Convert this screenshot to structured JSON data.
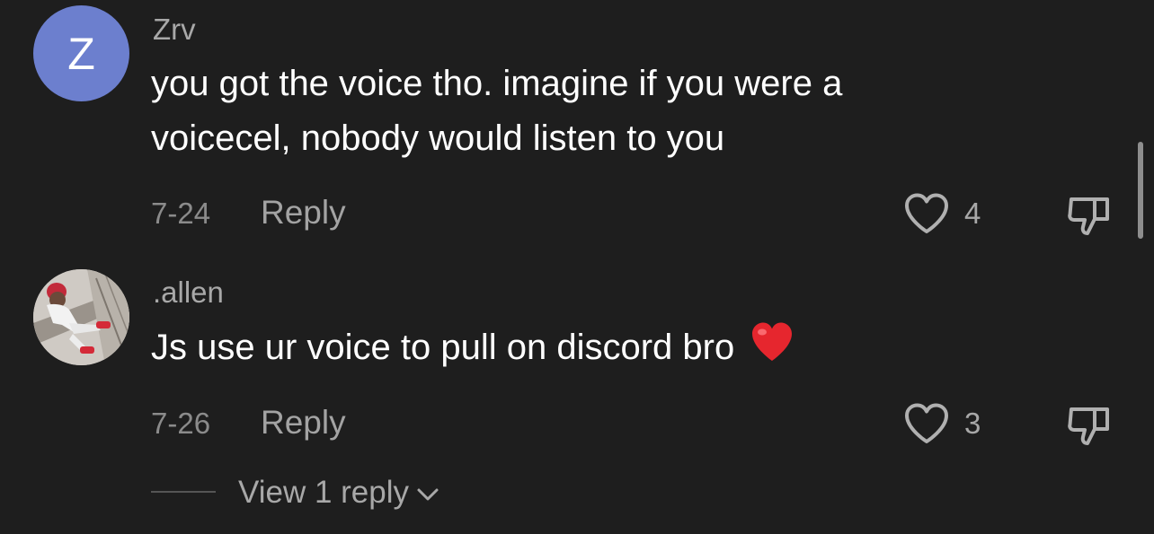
{
  "comments": [
    {
      "username": "Zrv",
      "avatar_letter": "Z",
      "text_line1": "you got the voice tho. imagine if you were a",
      "text_line2": "voicecel, nobody would listen to you",
      "date": "7-24",
      "reply_label": "Reply",
      "like_count": "4"
    },
    {
      "username": ".allen",
      "text": "Js use ur voice to pull on discord bro",
      "date": "7-26",
      "reply_label": "Reply",
      "like_count": "3"
    }
  ],
  "view_replies_label": "View 1 reply",
  "colors": {
    "background": "#1e1e1e",
    "avatar_z": "#6c7fce",
    "text": "#ffffff",
    "secondary_text": "#a8a8a8",
    "heart_emoji": "#e6262e"
  },
  "icons": [
    "heart-outline-icon",
    "thumbs-down-icon",
    "chevron-down-icon",
    "red-heart-emoji"
  ]
}
